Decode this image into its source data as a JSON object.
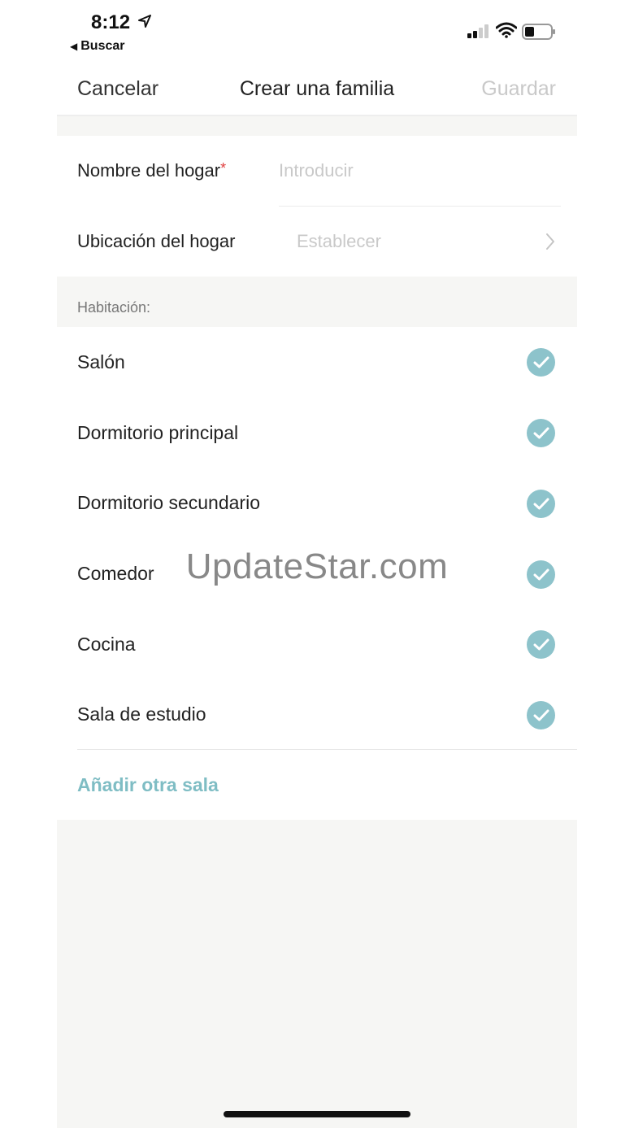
{
  "status_bar": {
    "time": "8:12",
    "back_app": "Buscar"
  },
  "nav": {
    "cancel": "Cancelar",
    "title": "Crear una familia",
    "save": "Guardar"
  },
  "form": {
    "home_name_label": "Nombre del hogar",
    "required_mark": "*",
    "home_name_placeholder": "Introducir",
    "home_location_label": "Ubicación del hogar",
    "home_location_placeholder": "Establecer"
  },
  "rooms": {
    "section_label": "Habitación:",
    "items": [
      {
        "label": "Salón",
        "checked": true
      },
      {
        "label": "Dormitorio principal",
        "checked": true
      },
      {
        "label": "Dormitorio secundario",
        "checked": true
      },
      {
        "label": "Comedor",
        "checked": true
      },
      {
        "label": "Cocina",
        "checked": true
      },
      {
        "label": "Sala de estudio",
        "checked": true
      }
    ],
    "add_label": "Añadir otra sala"
  },
  "watermark": "UpdateStar.com",
  "colors": {
    "accent": "#8dc3cb",
    "link": "#7fbdc4",
    "disabled": "#c9c9c9",
    "section_bg": "#f6f6f4",
    "required": "#e04040"
  },
  "icons": [
    "location-arrow-icon",
    "back-triangle-icon",
    "signal-icon",
    "wifi-icon",
    "battery-icon",
    "chevron-right-icon",
    "checkmark-icon"
  ]
}
